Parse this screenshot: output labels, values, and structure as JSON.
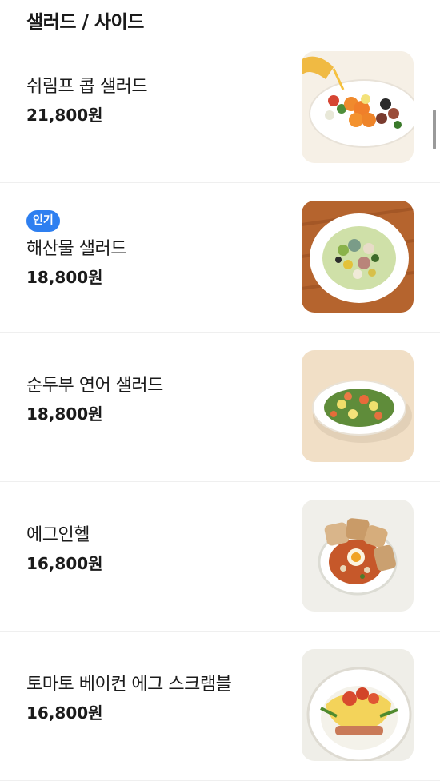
{
  "section": {
    "title": "샐러드 / 사이드"
  },
  "items": [
    {
      "name": "쉬림프 콥 샐러드",
      "price": "21,800원",
      "badge": "",
      "image_icon": "shrimp-cobb-salad-image"
    },
    {
      "name": "해산물 샐러드",
      "price": "18,800원",
      "badge": "인기",
      "image_icon": "seafood-salad-image"
    },
    {
      "name": "순두부 연어 샐러드",
      "price": "18,800원",
      "badge": "",
      "image_icon": "tofu-salmon-salad-image"
    },
    {
      "name": "에그인헬",
      "price": "16,800원",
      "badge": "",
      "image_icon": "egg-in-hell-image"
    },
    {
      "name": "토마토 베이컨 에그 스크램블",
      "price": "16,800원",
      "badge": "",
      "image_icon": "tomato-bacon-egg-scramble-image"
    }
  ],
  "colors": {
    "badge": "#2e7ff0",
    "divider": "#efefef",
    "text": "#1b1b1b"
  }
}
